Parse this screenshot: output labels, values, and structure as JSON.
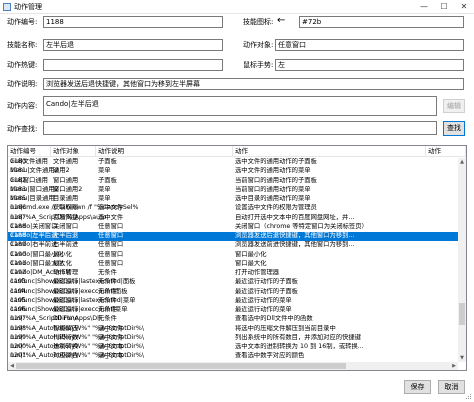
{
  "window": {
    "title": "动作管理",
    "min": "—",
    "max": "☐",
    "close": "✕"
  },
  "form": {
    "id_label": "动作编号:",
    "id_value": "1188",
    "icon_label": "技能图标:",
    "icon_arrow": "←",
    "icon_value": "#72b",
    "name_label": "技能名称:",
    "name_value": "左半后退",
    "target_label": "动作对象:",
    "target_value": "任意窗口",
    "hotkey_label": "动作热键:",
    "hotkey_value": "",
    "gesture_label": "鼠标手势:",
    "gesture_value": "左",
    "desc_label": "动作说明:",
    "desc_value": "浏览器发送后退快捷键，其他窗口为移到左半屏幕",
    "content_label": "动作内容:",
    "content_value": "Cando|左半后退",
    "edit_button": "编辑",
    "search_label": "动作查找:",
    "search_value": "",
    "search_button": "查找"
  },
  "table": {
    "columns": [
      "动作编号",
      "动作对象",
      "动作说明",
      "动作",
      "动作"
    ],
    "selected_index": 8,
    "rows": [
      [
        "1180",
        "文件通用",
        "子面板",
        "选中文件的通用动作的子面板",
        "Gui|文件通用"
      ],
      [
        "1181",
        "通用2",
        "菜单",
        "选中文件的通用动作的菜单",
        "Menu|文件通用2"
      ],
      [
        "1182",
        "窗口通用",
        "子面板",
        "当前窗口的通用动作的子面板",
        "Gui|窗口通用"
      ],
      [
        "1183",
        "窗口通用2",
        "菜单",
        "当前窗口的通用动作的菜单",
        "Menu|窗口通用2"
      ],
      [
        "1185",
        "目录通用",
        "菜单",
        "选中目录的通用动作的菜单",
        "Menu|目录通用"
      ],
      [
        "1186",
        "获取权限",
        "选中文件",
        "设置选中文件的权限为管理员",
        "run|cmd.exe /c takeown /f \"%CandySel%"
      ],
      [
        "1187",
        "百度网盘",
        "选中文件",
        "自动打开选中文本中的百度网盘网址，并...",
        "run|\"%A_ScriptDir%\\Apps\\auto"
      ],
      [
        "1188",
        "关闭窗口",
        "任意窗口",
        "关闭窗口（chrome 等特定窗口为关闭标签页）",
        "Cando|关闭窗口"
      ],
      [
        "1188",
        "左半后退",
        "任意窗口",
        "浏览器发送后退快捷键，其他窗口为移到...",
        "Cando|左半后退"
      ],
      [
        "1189",
        "右半前进",
        "任意窗口",
        "浏览器发送前进快捷键，其他窗口为移到...",
        "Cando|右半前进"
      ],
      [
        "1190",
        "最小化",
        "任意窗口",
        "窗口最小化",
        "Cando|窗口最小化"
      ],
      [
        "1191",
        "最大化",
        "任意窗口",
        "窗口最大化",
        "Cando|窗口最大化"
      ],
      [
        "1192",
        "动作管理",
        "无条件",
        "打开动作管理器",
        "Cando|DM_ActionM"
      ],
      [
        "1193",
        "最近运行",
        "无条件",
        "最近运行动作的子面板",
        "canfunc|ShowDBData|lastexecuted|面板"
      ],
      [
        "1194",
        "最近运行",
        "无条件",
        "最近运行动作的子面板",
        "canfunc|ShowDBData|execcount|面板"
      ],
      [
        "1195",
        "最近运行",
        "无条件",
        "最近运行动作的菜单",
        "canfunc|ShowDBData|lastexecuted|菜单"
      ],
      [
        "1196",
        "最近运行",
        "无条件",
        "最近运行动作的菜单",
        "canfunc|ShowDBData|execcount|菜单"
      ],
      [
        "1197",
        "Dll Func",
        "无条件",
        "查看选中的Dll文件中的函数",
        "run|\"%A_ScriptDir%\\Apps\\Dll"
      ],
      [
        "1198",
        "智能解压",
        "选中文件",
        "将选中的压缩文件解压到当前目录中",
        "run|\"%A_AutohotkeyW%\" \"%A_ScriptDir%\\"
      ],
      [
        "1199",
        "代码行数",
        "选中文件",
        "列出系统中的所有数目，并添加对应的快捷键",
        "run|\"%A_AutohotkeyW%\" \"%A_ScriptDir%\\"
      ],
      [
        "1200",
        "进制转换",
        "选中文本",
        "选中文本的进制转换为 10 到 16制，或转换...",
        "run|\"%A_AutohotkeyW%\" \"%A_ScriptDir%\\"
      ],
      [
        "1201",
        "对应颜色",
        "选中文本",
        "查看选中数字对应的颜色",
        "run|\"%A_AutohotkeyW%\" \"%A_ScriptDir%\\"
      ]
    ]
  },
  "footer": {
    "save_button": "保存",
    "cancel_button": "取消"
  },
  "scroll": {
    "up": "▲",
    "down": "▼",
    "left": "◀",
    "right": "▶"
  }
}
